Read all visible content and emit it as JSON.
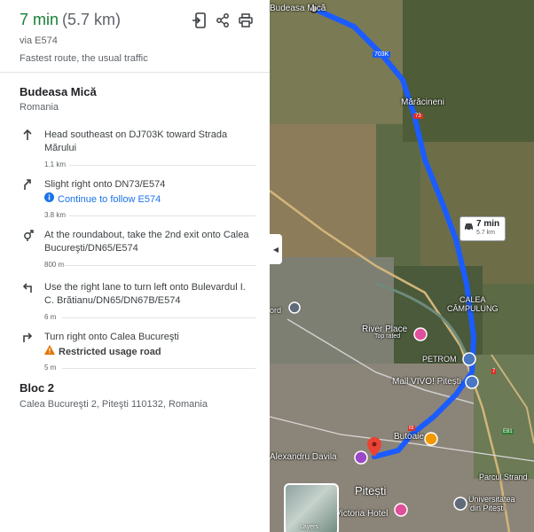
{
  "summary": {
    "duration": "7 min",
    "distance": "(5.7 km)",
    "via": "via E574",
    "traffic": "Fastest route, the usual traffic"
  },
  "toolbar": {
    "icons": [
      "send-to-phone-icon",
      "share-icon",
      "print-icon"
    ]
  },
  "origin": {
    "name": "Budeasa Mică",
    "region": "Romania"
  },
  "steps": [
    {
      "icon": "arrow-up-icon",
      "text": "Head southeast on DJ703K toward Strada Mărului",
      "distance": "1.1 km"
    },
    {
      "icon": "slight-right-icon",
      "text": "Slight right onto DN73/E574",
      "subtext": "Continue to follow E574",
      "distance": "3.8 km"
    },
    {
      "icon": "roundabout-icon",
      "text": "At the roundabout, take the 2nd exit onto Calea Bucureşti/DN65/E574",
      "distance": "800 m"
    },
    {
      "icon": "turn-left-icon",
      "text": "Use the right lane to turn left onto Bulevardul I. C. Brătianu/DN65/DN67B/E574",
      "distance": "6 m"
    },
    {
      "icon": "turn-right-icon",
      "text": "Turn right onto Calea Bucureşti",
      "warning": "Restricted usage road",
      "distance": "5 m"
    }
  ],
  "destination": {
    "name": "Bloc 2",
    "address": "Calea Bucureşti 2, Piteşti 110132, Romania"
  },
  "map": {
    "route_color": "#1a5cff",
    "labels": {
      "top_place": "Budeasa Mică",
      "road_703k": "703K",
      "maracineni": "Mărăcineni",
      "road_73": "73",
      "calea1": "CALEA",
      "calea2": "CÂMPULUNG",
      "river_place": "River Place",
      "top_rated": "Top rated",
      "petrom": "PETROM",
      "mall": "Mall VIVO! Pitești",
      "butoaie": "Butoaie",
      "alexandru": "Alexandru Davila",
      "ord": "ord",
      "pitesti": "Pitești",
      "victoria": "Victoria Hotel",
      "univ1": "Universitatea",
      "univ2": "din Pitești",
      "parcul": "Parcul Ștrand",
      "e81": "E81",
      "road_65": "65",
      "road_7": "7"
    },
    "bubble": {
      "time": "7 min",
      "dist": "5.7 km"
    },
    "layers_label": "Layers"
  }
}
